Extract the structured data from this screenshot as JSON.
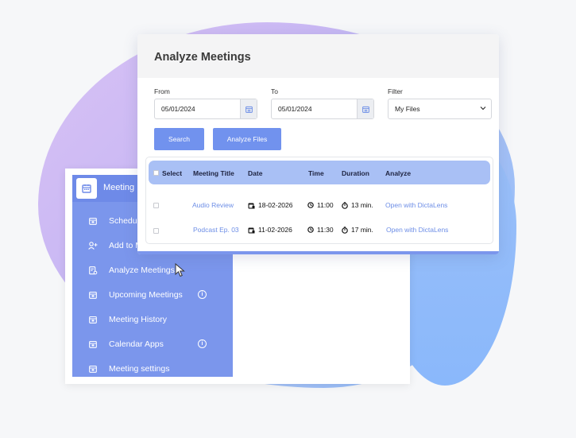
{
  "card": {
    "title": "Analyze Meetings",
    "from_label": "From",
    "from_value": "05/01/2024",
    "to_label": "To",
    "to_value": "05/01/2024",
    "filter_label": "Filter",
    "filter_value": "My Files",
    "search_button": "Search",
    "analyze_button": "Analyze Files"
  },
  "table": {
    "headers": [
      "Select",
      "Meeting Title",
      "Date",
      "Time",
      "Duration",
      "Analyze"
    ],
    "rows": [
      {
        "title": "Audio Review",
        "date": "18-02-2026",
        "time": "11:00",
        "duration": "13 min.",
        "action": "Open with DictaLens"
      },
      {
        "title": "Podcast Ep. 03",
        "date": "11-02-2026",
        "time": "11:30",
        "duration": "17 min.",
        "action": "Open with DictaLens"
      }
    ]
  },
  "sidebar": {
    "header_label": "Meeting",
    "items": [
      {
        "label": "Schedu",
        "icon": "calendar-icon"
      },
      {
        "label": "Add to M",
        "icon": "add-user-icon"
      },
      {
        "label": "Analyze Meetings",
        "icon": "analyze-doc-icon"
      },
      {
        "label": "Upcoming Meetings",
        "icon": "calendar-icon"
      },
      {
        "label": "Meeting History",
        "icon": "calendar-icon"
      },
      {
        "label": "Calendar Apps",
        "icon": "calendar-icon"
      },
      {
        "label": "Meeting settings",
        "icon": "calendar-icon"
      }
    ]
  },
  "colors": {
    "accent": "#7192ee",
    "sidebar": "#7b96ec",
    "table_header": "#a9c0f5",
    "link": "#6d8ee6"
  }
}
